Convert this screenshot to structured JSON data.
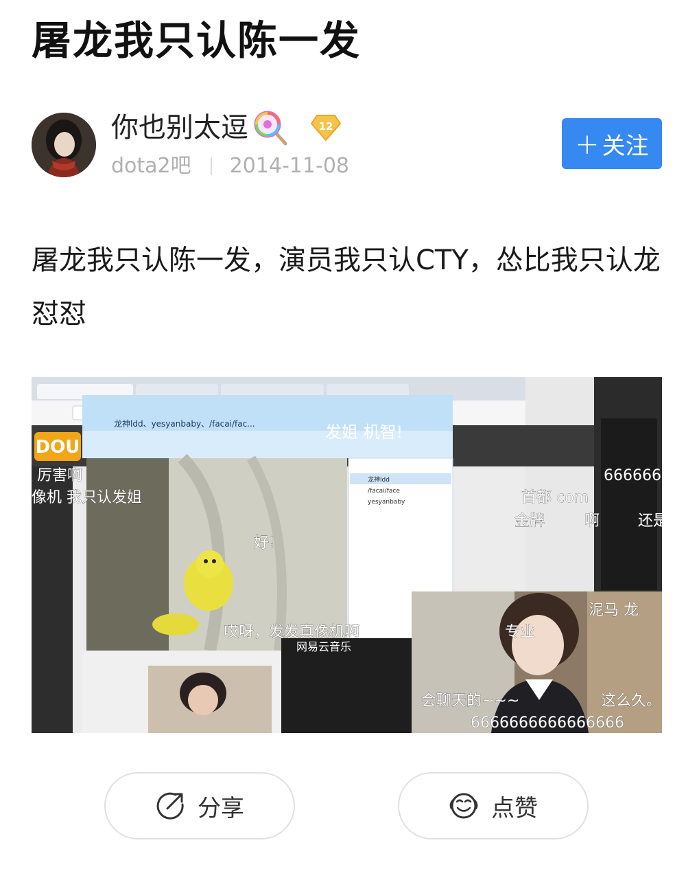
{
  "post": {
    "title": "屠龙我只认陈一发",
    "body": "屠龙我只认陈一发，演员我只认CTY，怂比我只认龙怼怼"
  },
  "author": {
    "name": "你也别太逗",
    "level": "12",
    "forum": "dota2吧",
    "date": "2014-11-08",
    "follow_label": "关注"
  },
  "screenshot": {
    "chat_title": "龙神ldd、yesyanbaby、/facai/fac...",
    "chat_banner": "发姐 机智!",
    "douyu_logo": "DOU",
    "music_app": "网易云音乐",
    "danmaku": [
      "厉害啊",
      "像机 我只认发姐",
      "好!",
      "哎呀，发发真像机啊",
      "666666",
      "首都 com",
      "金牌",
      "啊",
      "还是",
      "专业",
      "泥马 龙",
      "会聊天的~~~",
      "这么久。",
      "6666666666666666"
    ],
    "member_list": [
      "龙神ldd",
      "/facai/face",
      "yesyanbaby"
    ]
  },
  "actions": {
    "share_label": "分享",
    "like_label": "点赞"
  },
  "colors": {
    "follow_button": "#3589f0",
    "level_badge": "#f6c24a"
  }
}
